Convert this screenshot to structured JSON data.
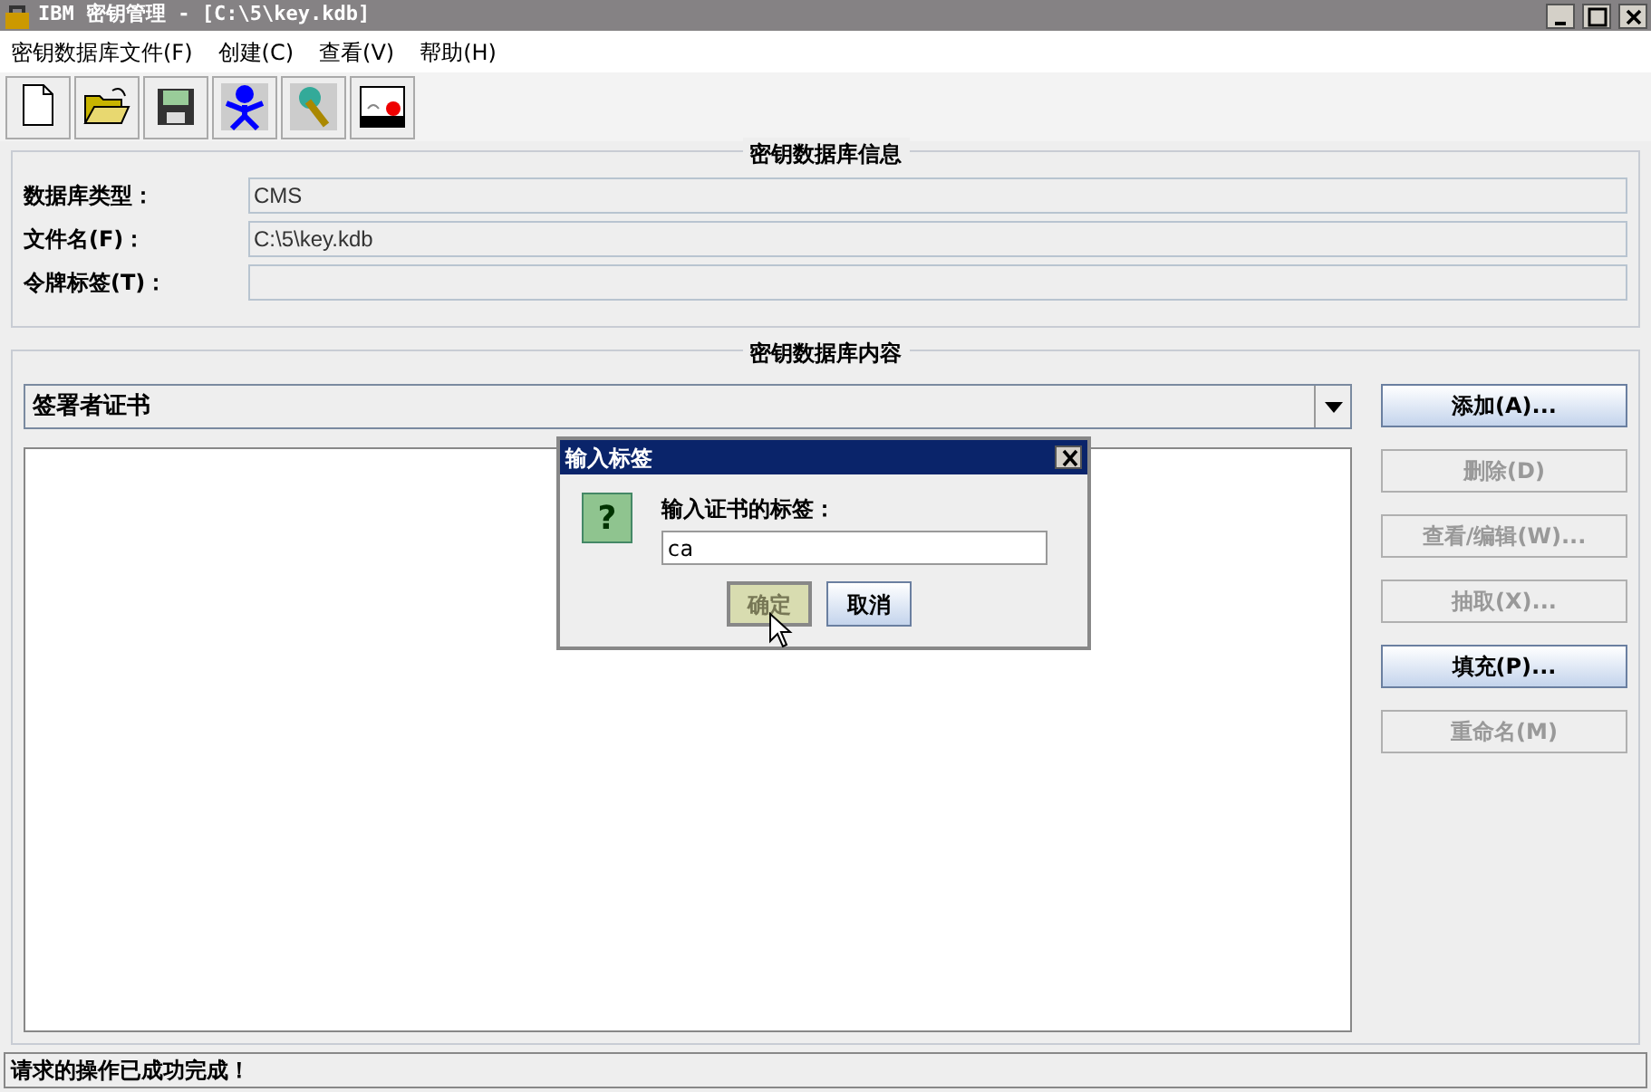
{
  "window": {
    "title": "IBM 密钥管理 - [C:\\5\\key.kdb]"
  },
  "menu": [
    "密钥数据库文件(F)",
    "创建(C)",
    "查看(V)",
    "帮助(H)"
  ],
  "info_panel": {
    "title": "密钥数据库信息",
    "fields": [
      {
        "label": "数据库类型：",
        "value": "CMS"
      },
      {
        "label": "文件名(F)：",
        "value": "C:\\5\\key.kdb"
      },
      {
        "label": "令牌标签(T)："
      }
    ]
  },
  "content_panel": {
    "title": "密钥数据库内容",
    "dropdown": "签署者证书",
    "buttons": [
      {
        "label": "添加(A)...",
        "disabled": false
      },
      {
        "label": "删除(D)",
        "disabled": true
      },
      {
        "label": "查看/编辑(W)...",
        "disabled": true
      },
      {
        "label": "抽取(X)...",
        "disabled": true
      },
      {
        "label": "填充(P)...",
        "disabled": false
      },
      {
        "label": "重命名(M)",
        "disabled": true
      }
    ]
  },
  "dialog": {
    "title": "输入标签",
    "icon": "?",
    "prompt": "输入证书的标签：",
    "value": "ca",
    "buttons": [
      "确定",
      "取消"
    ]
  },
  "status_bar": "请求的操作已成功完成！"
}
